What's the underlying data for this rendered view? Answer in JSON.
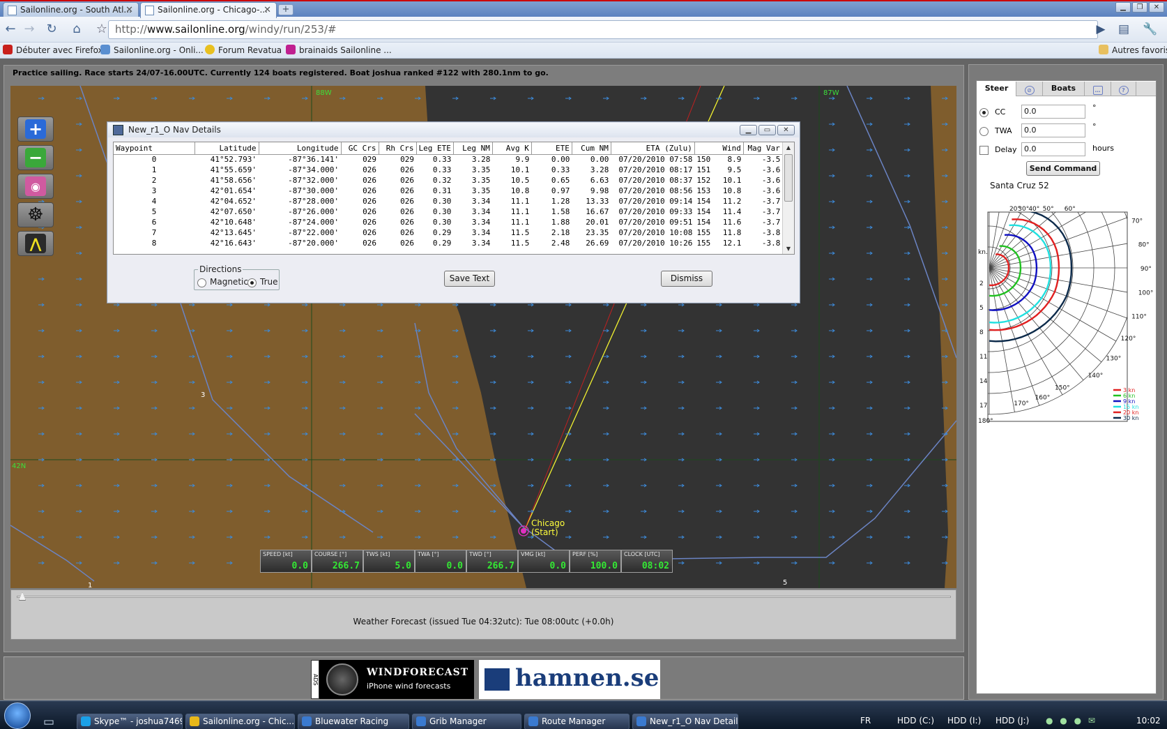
{
  "browser": {
    "tabs": [
      {
        "title": "Sailonline.org - South Atl..."
      },
      {
        "title": "Sailonline.org - Chicago-..."
      }
    ],
    "url_prefix": "http://",
    "url_host": "www.sailonline.org",
    "url_path": "/windy/run/253/#",
    "bookmarks": [
      {
        "label": "Débuter avec Firefox"
      },
      {
        "label": "Sailonline.org - Onli..."
      },
      {
        "label": "Forum Revatua"
      },
      {
        "label": "brainaids Sailonline ..."
      }
    ],
    "other_bookmarks": "Autres favoris"
  },
  "status_text": "Practice sailing. Race starts 24/07-16.00UTC. Currently 124 boats registered. Boat joshua ranked #122 with 280.1nm to go.",
  "map": {
    "grid_labels": {
      "lon_left": "88W",
      "lon_right": "87W",
      "lat": "42N"
    },
    "waypoint_numbers": [
      "3",
      "1",
      "5"
    ],
    "city": {
      "name": "Chicago",
      "sub": "(Start)"
    },
    "tools": [
      {
        "name": "zoom-in-icon"
      },
      {
        "name": "zoom-out-icon"
      },
      {
        "name": "compass-icon"
      },
      {
        "name": "helm-icon"
      },
      {
        "name": "divider-icon"
      }
    ]
  },
  "instruments": [
    {
      "label": "SPEED [kt]",
      "value": "0.0"
    },
    {
      "label": "COURSE [°]",
      "value": "266.7"
    },
    {
      "label": "TWS [kt]",
      "value": "5.0"
    },
    {
      "label": "TWA [°]",
      "value": "0.0"
    },
    {
      "label": "TWD [°]",
      "value": "266.7"
    },
    {
      "label": "VMG [kt]",
      "value": "0.0"
    },
    {
      "label": "PERF [%]",
      "value": "100.0"
    },
    {
      "label": "CLOCK [UTC]",
      "value": "08:02"
    }
  ],
  "forecast": {
    "text": "Weather Forecast  (issued Tue 04:32utc): Tue 08:00utc  (+0.0h)",
    "slider_fraction": 0.0
  },
  "ads": {
    "ads_label": "ADS",
    "windforecast_title": "WINDFORECAST",
    "windforecast_sub": "iPhone wind forecasts",
    "hamnen": "hamnen.se"
  },
  "steer_panel": {
    "tabs": [
      "Steer",
      "Boats"
    ],
    "cc_label": "CC",
    "cc_value": "0.0",
    "cc_unit": "°",
    "twa_label": "TWA",
    "twa_value": "0.0",
    "twa_unit": "°",
    "delay_label": "Delay",
    "delay_value": "0.0",
    "delay_unit": "hours",
    "send_label": "Send Command",
    "selected_mode": "CC"
  },
  "polar": {
    "title": "Santa Cruz 52",
    "angle_labels": [
      "20°",
      "30°",
      "40°",
      "50°",
      "60°",
      "70°",
      "80°",
      "90°",
      "100°",
      "110°",
      "120°",
      "130°",
      "140°",
      "150°",
      "160°",
      "170°",
      "180°"
    ],
    "speed_labels": [
      "kn.",
      "2",
      "5",
      "8",
      "11",
      "14",
      "17"
    ],
    "legend": [
      {
        "label": "3 kn",
        "color": "#e02020"
      },
      {
        "label": "6 kn",
        "color": "#20c020"
      },
      {
        "label": "9 kn",
        "color": "#1010c0"
      },
      {
        "label": "15 kn",
        "color": "#20e0e0"
      },
      {
        "label": "20 kn",
        "color": "#e02020"
      },
      {
        "label": "30 kn",
        "color": "#0c2a4a"
      }
    ]
  },
  "nav_dialog": {
    "title": "New_r1_O Nav Details",
    "columns": [
      "Waypoint",
      "Latitude",
      "Longitude",
      "GC Crs",
      "Rh Crs",
      "Leg ETE",
      "Leg NM",
      "Avg K",
      "ETE",
      "Cum NM",
      "ETA (Zulu)",
      "Wind",
      "Mag Var"
    ],
    "rows": [
      [
        "0",
        "41°52.793'",
        "-87°36.141'",
        "029",
        "029",
        "0.33",
        "3.28",
        "9.9",
        "0.00",
        "0.00",
        "07/20/2010 07:58",
        "150",
        "8.9",
        "-3.5"
      ],
      [
        "1",
        "41°55.659'",
        "-87°34.000'",
        "026",
        "026",
        "0.33",
        "3.35",
        "10.1",
        "0.33",
        "3.28",
        "07/20/2010 08:17",
        "151",
        "9.5",
        "-3.6"
      ],
      [
        "2",
        "41°58.656'",
        "-87°32.000'",
        "026",
        "026",
        "0.32",
        "3.35",
        "10.5",
        "0.65",
        "6.63",
        "07/20/2010 08:37",
        "152",
        "10.1",
        "-3.6"
      ],
      [
        "3",
        "42°01.654'",
        "-87°30.000'",
        "026",
        "026",
        "0.31",
        "3.35",
        "10.8",
        "0.97",
        "9.98",
        "07/20/2010 08:56",
        "153",
        "10.8",
        "-3.6"
      ],
      [
        "4",
        "42°04.652'",
        "-87°28.000'",
        "026",
        "026",
        "0.30",
        "3.34",
        "11.1",
        "1.28",
        "13.33",
        "07/20/2010 09:14",
        "154",
        "11.2",
        "-3.7"
      ],
      [
        "5",
        "42°07.650'",
        "-87°26.000'",
        "026",
        "026",
        "0.30",
        "3.34",
        "11.1",
        "1.58",
        "16.67",
        "07/20/2010 09:33",
        "154",
        "11.4",
        "-3.7"
      ],
      [
        "6",
        "42°10.648'",
        "-87°24.000'",
        "026",
        "026",
        "0.30",
        "3.34",
        "11.1",
        "1.88",
        "20.01",
        "07/20/2010 09:51",
        "154",
        "11.6",
        "-3.7"
      ],
      [
        "7",
        "42°13.645'",
        "-87°22.000'",
        "026",
        "026",
        "0.29",
        "3.34",
        "11.5",
        "2.18",
        "23.35",
        "07/20/2010 10:08",
        "155",
        "11.8",
        "-3.8"
      ],
      [
        "8",
        "42°16.643'",
        "-87°20.000'",
        "026",
        "026",
        "0.29",
        "3.34",
        "11.5",
        "2.48",
        "26.69",
        "07/20/2010 10:26",
        "155",
        "12.1",
        "-3.8"
      ]
    ],
    "directions_legend": "Directions",
    "magnetic_label": "Magnetic",
    "true_label": "True",
    "selected_direction": "True",
    "save_label": "Save Text",
    "dismiss_label": "Dismiss"
  },
  "taskbar": {
    "items": [
      {
        "label": "Skype™ - joshua7469",
        "color": "#1aa0e8"
      },
      {
        "label": "Sailonline.org - Chic...",
        "color": "#e8b81a"
      },
      {
        "label": "Bluewater Racing",
        "color": "#3a7ad0"
      },
      {
        "label": "Grib Manager",
        "color": "#3a7ad0"
      },
      {
        "label": "Route Manager",
        "color": "#3a7ad0"
      },
      {
        "label": "New_r1_O Nav Details",
        "color": "#3a7ad0"
      }
    ],
    "lang": "FR",
    "drives": [
      "HDD (C:)",
      "HDD (I:)",
      "HDD (J:)"
    ],
    "clock": "10:02"
  }
}
